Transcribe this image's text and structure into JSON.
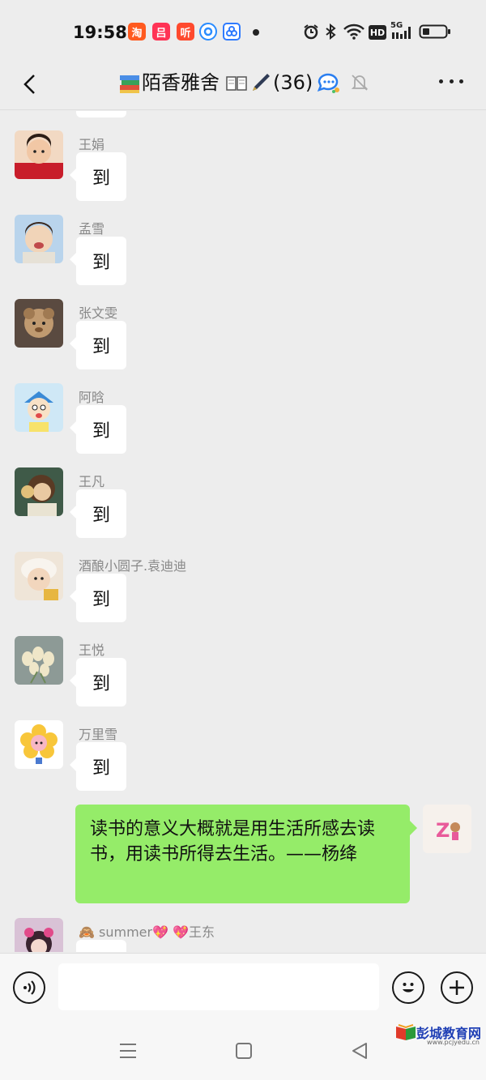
{
  "status_bar": {
    "time": "19:58",
    "apps": [
      {
        "glyph": "淘",
        "color": "#ff5a1f",
        "icon": "taobao-icon"
      },
      {
        "glyph": "吕",
        "color": "#ff3355",
        "icon": "app-pink-icon"
      },
      {
        "glyph": "听",
        "color": "#ff4a2e",
        "icon": "listen-app-icon"
      },
      {
        "glyph": "◔",
        "color": "#2a8cff",
        "icon": "browser-icon"
      },
      {
        "glyph": "⚙",
        "color": "#2f7bff",
        "icon": "app-blue-icon"
      }
    ],
    "hd_label": "HD",
    "network_label": "5G"
  },
  "title_bar": {
    "title": "陌香雅舍",
    "member_count": "(36)"
  },
  "messages": [
    {
      "sender": "王娟",
      "text": "到",
      "avatar_colors": [
        "#c81d2a",
        "#f4c8a8"
      ]
    },
    {
      "sender": "孟雪",
      "text": "到",
      "avatar_colors": [
        "#b9d4ec",
        "#f1d4b8"
      ]
    },
    {
      "sender": "张文雯",
      "text": "到",
      "avatar_colors": [
        "#5a4a40",
        "#c09a70"
      ]
    },
    {
      "sender": "阿晗",
      "text": "到",
      "avatar_colors": [
        "#cfe8f6",
        "#f7e26b"
      ]
    },
    {
      "sender": "王凡",
      "text": "到",
      "avatar_colors": [
        "#3f5a48",
        "#e9c9a2"
      ]
    },
    {
      "sender": "酒酿小圆子.袁迪迪",
      "text": "到",
      "avatar_colors": [
        "#efe5d8",
        "#d9b58d"
      ]
    },
    {
      "sender": "王悦",
      "text": "到",
      "avatar_colors": [
        "#8d9a96",
        "#efe6c8"
      ]
    },
    {
      "sender": "万里雪",
      "text": "到",
      "avatar_colors": [
        "#ffffff",
        "#f8c63a"
      ]
    }
  ],
  "outgoing": {
    "text": "读书的意义大概就是用生活所感去读书，用读书所得去生活。——杨绛"
  },
  "last_message": {
    "sender": "🙈 summer💖 💖王东"
  },
  "input": {
    "value": "",
    "placeholder": ""
  },
  "watermark": {
    "text": "彭城教育网",
    "url": "www.pcjyedu.cn"
  }
}
